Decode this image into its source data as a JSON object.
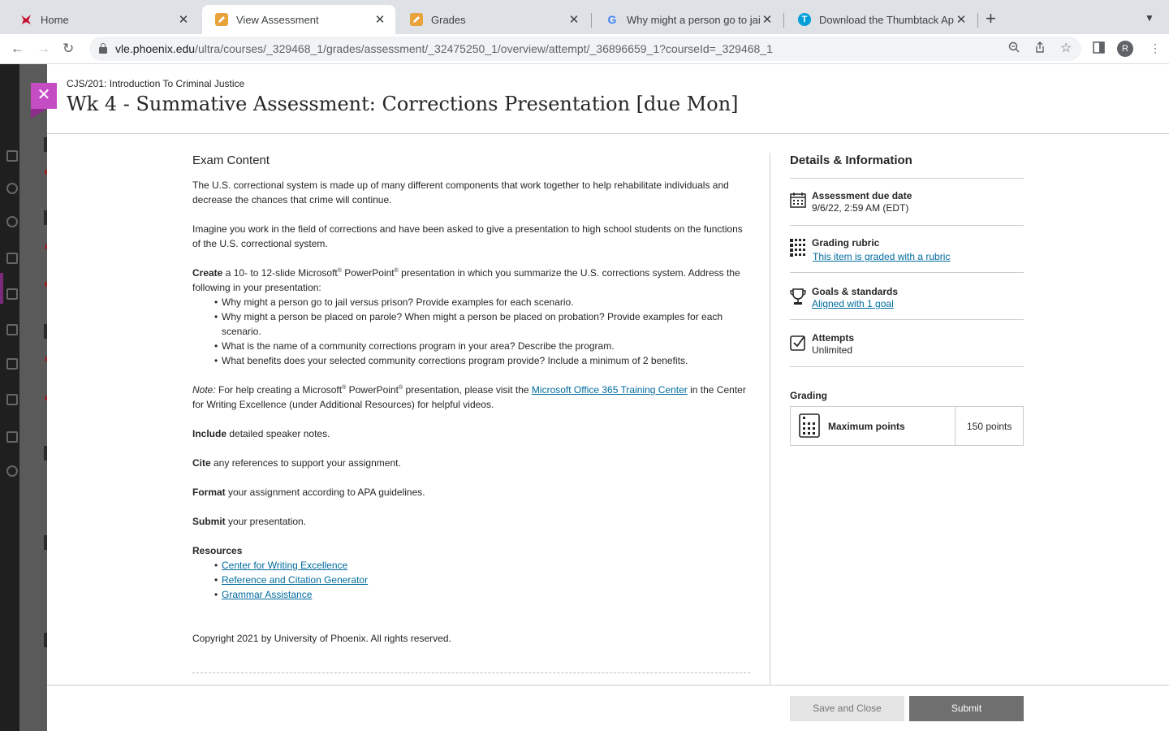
{
  "browser": {
    "tabs": [
      {
        "title": "Home",
        "favicon": "phoenix-bird-icon",
        "active": false
      },
      {
        "title": "View Assessment",
        "favicon": "pencil-icon",
        "active": true
      },
      {
        "title": "Grades",
        "favicon": "pencil-icon",
        "active": false
      },
      {
        "title": "Why might a person go to jail v",
        "favicon": "google-icon",
        "active": false
      },
      {
        "title": "Download the Thumbtack App",
        "favicon": "thumbtack-icon",
        "active": false
      }
    ],
    "url_host": "vle.phoenix.edu",
    "url_path": "/ultra/courses/_329468_1/grades/assessment/_32475250_1/overview/attempt/_36896659_1?courseId=_329468_1",
    "profile_initial": "R"
  },
  "header": {
    "course": "CJS/201: Introduction To Criminal Justice",
    "title": "Wk 4 - Summative Assessment: Corrections Presentation [due Mon]"
  },
  "content": {
    "heading": "Exam Content",
    "intro1": "The U.S. correctional system is made up of many different components that work together to help rehabilitate individuals and decrease the chances that crime will continue.",
    "intro2": "Imagine you work in the field of corrections and have been asked to give a presentation to high school students on the functions of the U.S. correctional system.",
    "create_bold": "Create",
    "create_text_1": " a 10- to 12-slide Microsoft",
    "create_text_2": " PowerPoint",
    "create_text_3": " presentation in which you summarize the U.S. corrections system. Address the following in your presentation:",
    "bullets": [
      "Why might a person go to jail versus prison? Provide examples for each scenario.",
      "Why might a person be placed on parole? When might a person be placed on probation? Provide examples for each scenario.",
      "What is the name of a community corrections program in your area? Describe the program.",
      "What benefits does your selected community corrections program provide? Include a minimum of 2 benefits."
    ],
    "note_italic": "Note:",
    "note_text_1": " For help creating a Microsoft",
    "note_text_2": " PowerPoint",
    "note_text_3": " presentation, please visit the ",
    "note_link": "Microsoft Office 365 Training Center",
    "note_text_4": " in the Center for Writing Excellence (under Additional Resources) for helpful videos.",
    "registered": "®",
    "include_bold": "Include",
    "include_text": " detailed speaker notes.",
    "cite_bold": "Cite",
    "cite_text": " any references to support your assignment.",
    "format_bold": "Format",
    "format_text": " your assignment according to APA guidelines.",
    "submit_bold": "Submit",
    "submit_text": " your presentation.",
    "resources_heading": "Resources",
    "resources": [
      "Center for Writing Excellence",
      "Reference and Citation Generator",
      "Grammar Assistance"
    ],
    "copyright": "Copyright 2021 by University of Phoenix. All rights reserved."
  },
  "details": {
    "heading": "Details & Information",
    "due_label": "Assessment due date",
    "due_value": "9/6/22, 2:59 AM (EDT)",
    "rubric_label": "Grading rubric",
    "rubric_link": "This item is graded with a rubric",
    "goals_label": "Goals & standards",
    "goals_link": "Aligned with 1 goal",
    "attempts_label": "Attempts",
    "attempts_value": "Unlimited",
    "grading_heading": "Grading",
    "max_points_label": "Maximum points",
    "max_points_value": "150 points"
  },
  "footer": {
    "save_label": "Save and Close",
    "submit_label": "Submit"
  },
  "colors": {
    "accent": "#c54dc4",
    "link": "#006b9e",
    "submit_bg": "#6f6f6f"
  }
}
